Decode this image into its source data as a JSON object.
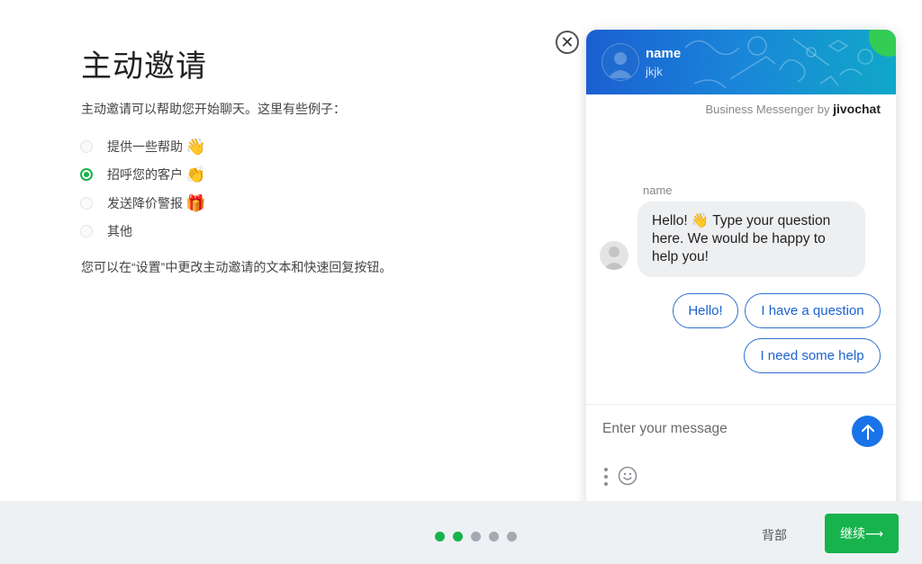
{
  "page": {
    "title": "主动邀请",
    "description": "主动邀请可以帮助您开始聊天。这里有些例子：",
    "options": [
      {
        "label": "提供一些帮助",
        "emoji": "👋",
        "checked": false
      },
      {
        "label": "招呼您的客户",
        "emoji": "👏",
        "checked": true
      },
      {
        "label": "发送降价警报",
        "emoji": "🎁",
        "checked": false
      },
      {
        "label": "其他",
        "emoji": "",
        "checked": false
      }
    ],
    "note": "您可以在“设置”中更改主动邀请的文本和快速回复按钮。"
  },
  "widget": {
    "header": {
      "name": "name",
      "subtitle": "jkjk"
    },
    "powered_prefix": "Business Messenger by",
    "powered_brand": "jivochat",
    "agent_name": "name",
    "message": "Hello! 👋 Type your question here. We would be happy to help you!",
    "quick_replies": [
      "Hello!",
      "I have a question",
      "I need some help"
    ],
    "input_placeholder": "Enter your message"
  },
  "footer": {
    "steps_total": 5,
    "active_steps": 2,
    "back_label": "背部",
    "next_label": "继续⟶"
  },
  "colors": {
    "accent_green": "#17b34d",
    "chat_blue": "#1a73e8",
    "header_gradient_start": "#1b5fd1",
    "header_gradient_end": "#10a8c8"
  }
}
